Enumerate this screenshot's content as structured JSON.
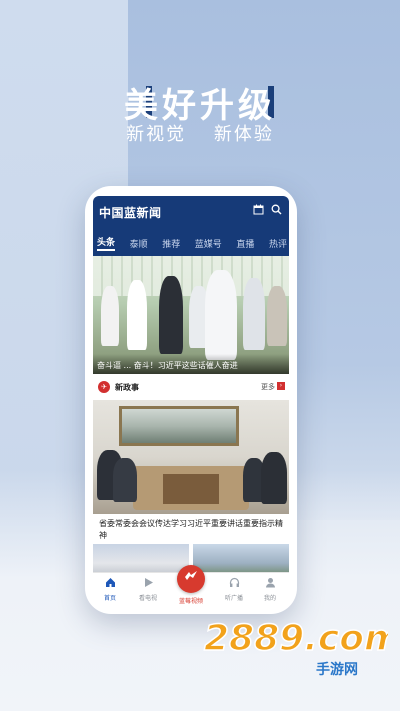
{
  "promo": {
    "headline": "美好升级",
    "sub_left": "新视觉",
    "sub_right": "新体验"
  },
  "app": {
    "title": "中国蓝新闻",
    "tabs": [
      "头条",
      "泰顺",
      "推荐",
      "蓝媒号",
      "直播",
      "热评"
    ],
    "active_tab": "头条"
  },
  "hero": {
    "caption": "奋斗逼 ... 奋斗！习近平这些话催人奋进"
  },
  "section": {
    "icon": "✈",
    "title": "新政事",
    "more": "更多"
  },
  "article": {
    "caption": "省委常委会会议传达学习习近平重要讲话重要指示精神"
  },
  "bottom_nav": [
    {
      "label": "首页",
      "icon": "home-icon",
      "active": true
    },
    {
      "label": "看电视",
      "icon": "play-icon",
      "active": false
    },
    {
      "label": "蓝莓视频",
      "icon": "bird-icon",
      "active": false
    },
    {
      "label": "听广播",
      "icon": "headphones-icon",
      "active": false
    },
    {
      "label": "我的",
      "icon": "user-icon",
      "active": false
    }
  ],
  "watermark": {
    "text": "2889.com",
    "sub": "手游网"
  },
  "colors": {
    "brand_blue": "#163a78",
    "accent_red": "#d23030"
  }
}
